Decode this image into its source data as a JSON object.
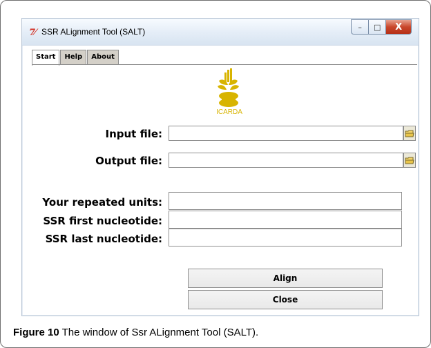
{
  "window": {
    "title": "SSR ALignment Tool (SALT)",
    "icon": "tk-feather-icon",
    "controls": [
      "minimize",
      "maximize",
      "close"
    ]
  },
  "tabs": [
    {
      "label": "Start",
      "selected": true
    },
    {
      "label": "Help",
      "selected": false
    },
    {
      "label": "About",
      "selected": false
    }
  ],
  "logo": {
    "text": "ICARDA",
    "color": "#d8b400"
  },
  "form": {
    "input_label": "Input file:",
    "output_label": "Output file:",
    "units_label": "Your repeated units:",
    "first_label": "SSR first nucleotide:",
    "last_label": "SSR last nucleotide:",
    "input_value": "",
    "output_value": "",
    "units_value": "",
    "first_value": "",
    "last_value": ""
  },
  "buttons": {
    "align": "Align",
    "close": "Close"
  },
  "caption": {
    "prefix": "Figure 10",
    "text": " The window of Ssr ALignment Tool (SALT)."
  }
}
